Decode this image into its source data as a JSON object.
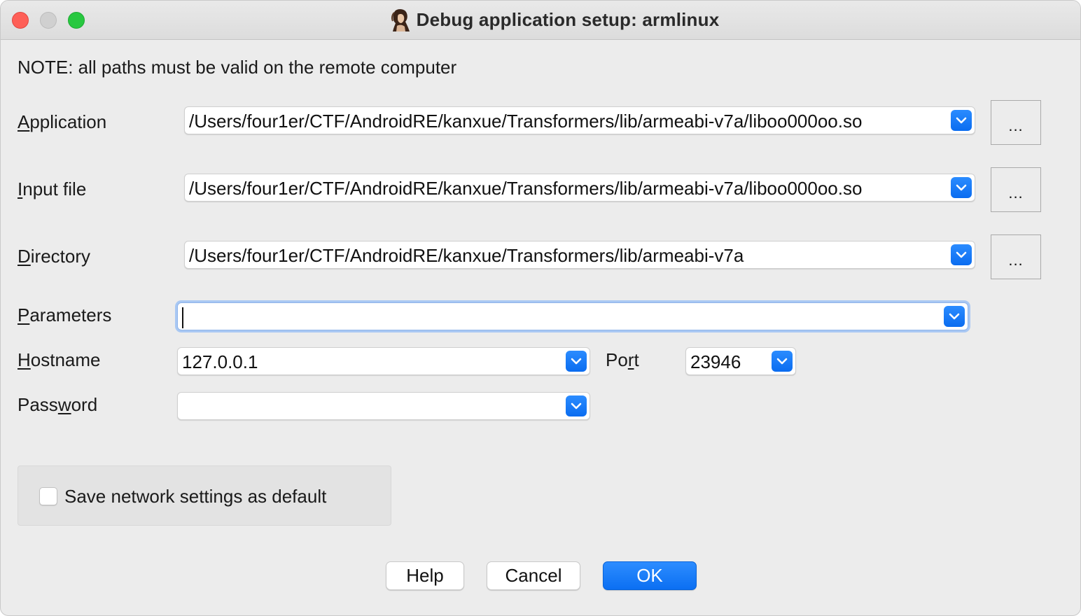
{
  "window": {
    "title": "Debug application setup: armlinux"
  },
  "note": "NOTE: all paths must be valid on the remote computer",
  "fields": {
    "application": {
      "label_prefix": "",
      "label_underlined": "A",
      "label_suffix": "pplication",
      "value": "/Users/four1er/CTF/AndroidRE/kanxue/Transformers/lib/armeabi-v7a/liboo000oo.so"
    },
    "input_file": {
      "label_prefix": "",
      "label_underlined": "I",
      "label_suffix": "nput file",
      "value": "/Users/four1er/CTF/AndroidRE/kanxue/Transformers/lib/armeabi-v7a/liboo000oo.so"
    },
    "directory": {
      "label_prefix": "",
      "label_underlined": "D",
      "label_suffix": "irectory",
      "value": "/Users/four1er/CTF/AndroidRE/kanxue/Transformers/lib/armeabi-v7a"
    },
    "parameters": {
      "label_prefix": "",
      "label_underlined": "P",
      "label_suffix": "arameters",
      "value": ""
    },
    "hostname": {
      "label_prefix": "",
      "label_underlined": "H",
      "label_suffix": "ostname",
      "value": "127.0.0.1"
    },
    "port": {
      "label_prefix": "Po",
      "label_underlined": "r",
      "label_suffix": "t",
      "value": "23946"
    },
    "password": {
      "label_prefix": "Pass",
      "label_underlined": "w",
      "label_suffix": "ord",
      "value": ""
    }
  },
  "browse_label": "...",
  "save_default": {
    "label": "Save network settings as default",
    "checked": false
  },
  "buttons": {
    "help": "Help",
    "cancel": "Cancel",
    "ok": "OK"
  },
  "colors": {
    "accent": "#0a6cf0",
    "window_bg": "#ececec",
    "close": "#fe5f57",
    "maximize": "#28c840"
  }
}
